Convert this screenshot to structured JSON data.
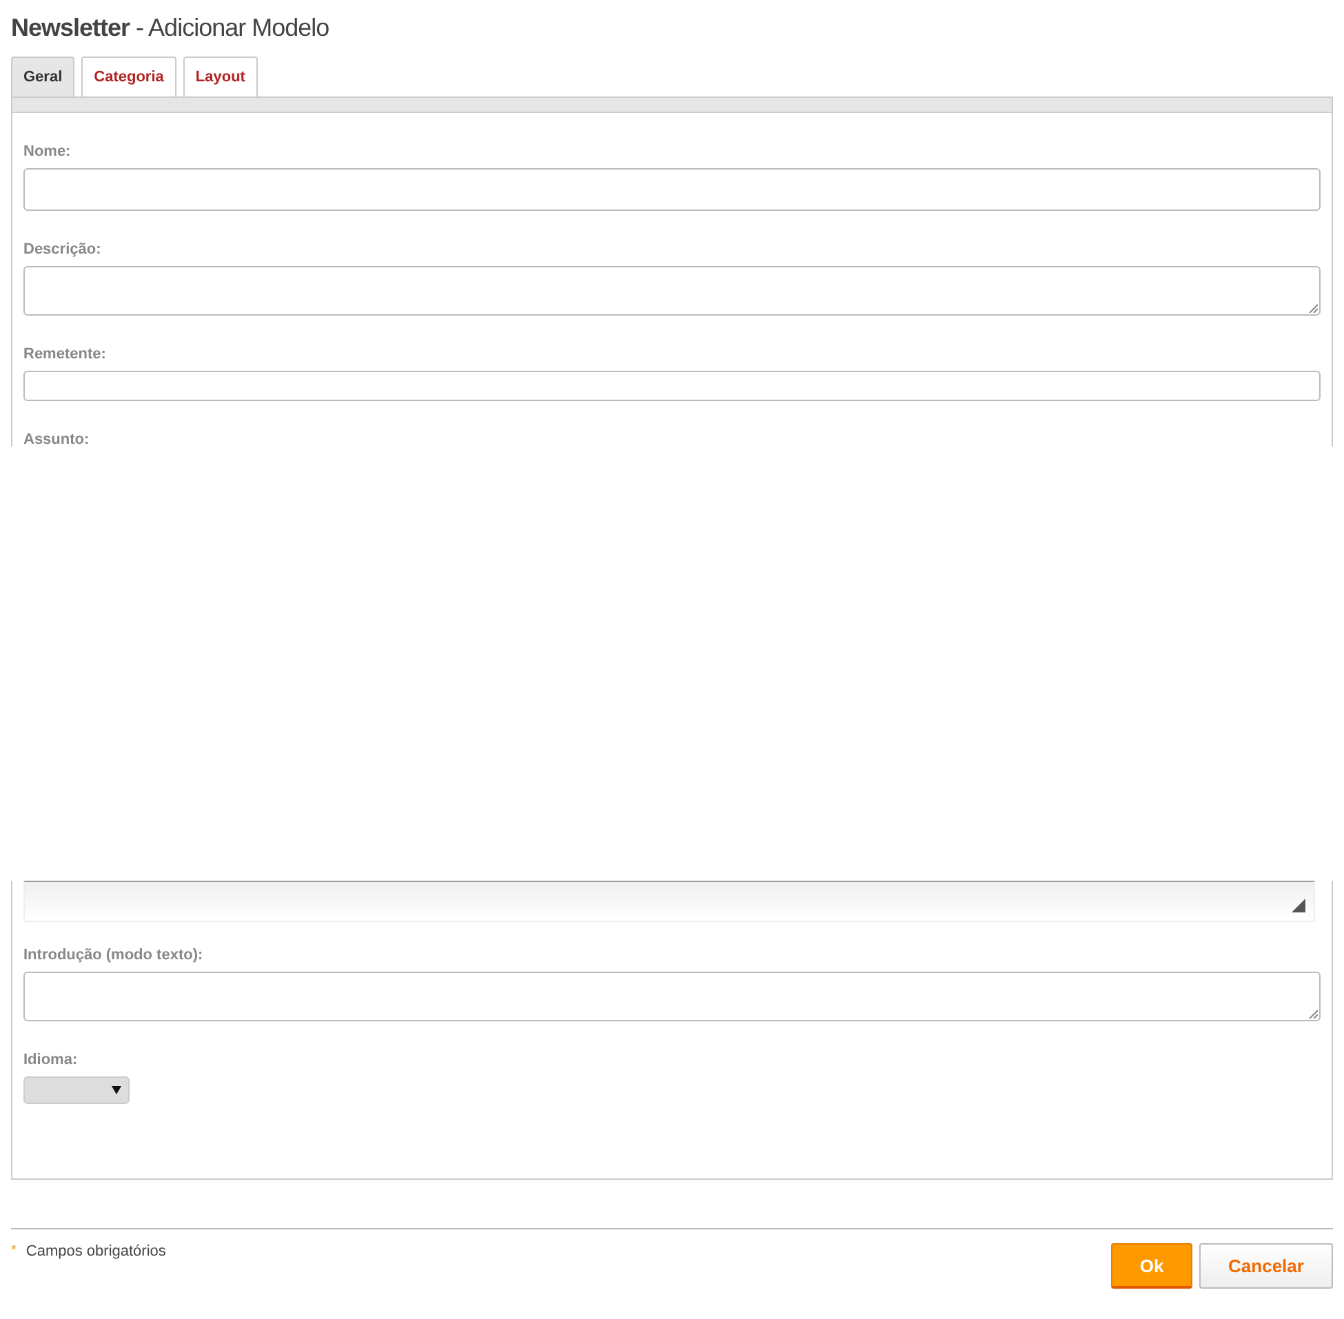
{
  "title": {
    "strong": "Newsletter",
    "rest": " - Adicionar Modelo"
  },
  "tabs": [
    {
      "label": "Geral",
      "selected": true
    },
    {
      "label": "Categoria",
      "selected": false
    },
    {
      "label": "Layout",
      "selected": false
    }
  ],
  "fields_top": [
    {
      "label": "Nome:",
      "kind": "input"
    },
    {
      "label": "Descrição:",
      "kind": "textarea"
    },
    {
      "label": "Remetente:",
      "kind": "small"
    },
    {
      "label": "Assunto:",
      "kind": "none"
    }
  ],
  "fields_bottom": [
    {
      "kind": "editor"
    },
    {
      "label": "Introdução (modo texto):",
      "kind": "textarea"
    },
    {
      "label": "Idioma:",
      "kind": "select"
    }
  ],
  "footer": {
    "marker": "*",
    "note": "Campos obrigatórios"
  },
  "buttons": [
    {
      "label": "Ok",
      "kind": "primary"
    },
    {
      "label": "Cancelar",
      "kind": "secondary"
    }
  ]
}
